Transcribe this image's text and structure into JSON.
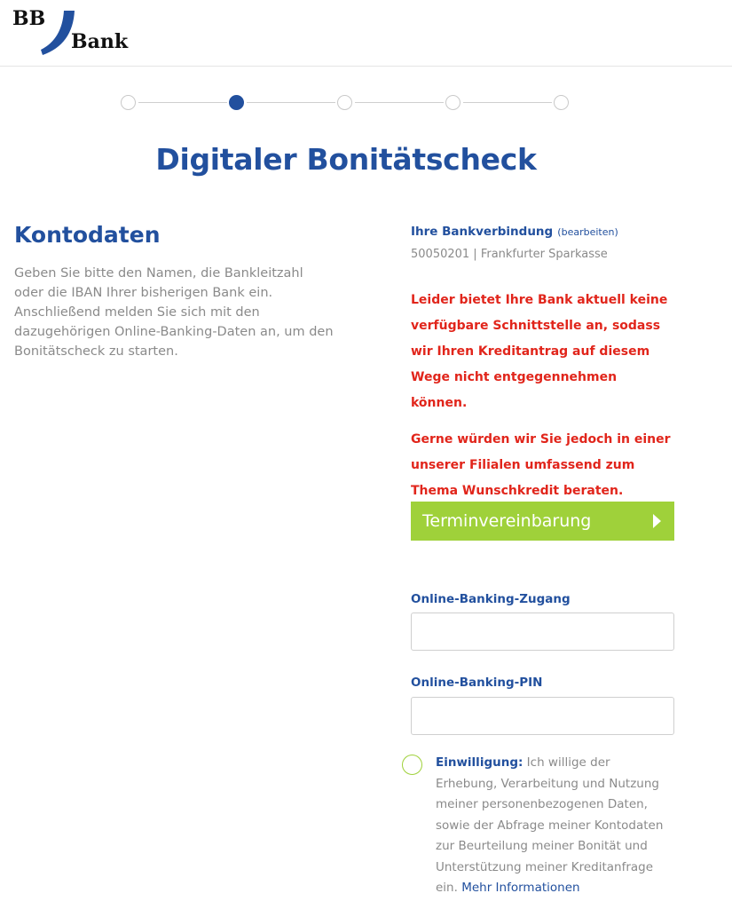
{
  "header": {
    "logo_bb": "BB",
    "logo_bank": "Bank",
    "brand_color": "#22509e"
  },
  "stepper": {
    "total": 5,
    "active_index": 1
  },
  "page": {
    "title": "Digitaler Bonitätscheck"
  },
  "left": {
    "heading": "Kontodaten",
    "description": "Geben Sie bitte den Namen, die Bankleitzahl oder die IBAN Ihrer bisherigen Bank ein. Anschließend melden Sie sich mit den dazugehörigen Online-Banking-Daten an, um den Bonitätscheck zu starten."
  },
  "bank": {
    "label": "Ihre Bankverbindung",
    "edit_link": "(bearbeiten)",
    "info": "50050201 | Frankfurter Sparkasse"
  },
  "errors": {
    "line1": "Leider bietet Ihre Bank aktuell keine verfügbare Schnittstelle an, sodass wir Ihren Kreditantrag auf diesem Wege nicht entgegennehmen können.",
    "line2": "Gerne würden wir Sie jedoch in einer unserer Filialen umfassend zum Thema Wunschkredit beraten.",
    "color": "#e1251b"
  },
  "cta": {
    "label": "Terminvereinbarung",
    "color": "#9fd13a"
  },
  "form": {
    "login_label": "Online-Banking-Zugang",
    "login_value": "",
    "pin_label": "Online-Banking-PIN",
    "pin_value": ""
  },
  "consent": {
    "title": "Einwilligung:",
    "text": " Ich willige der Erhebung, Verarbeitung und Nutzung meiner personenbezogenen Daten, sowie der Abfrage meiner Kontodaten zur Beurteilung meiner Bonität und Unterstützung meiner Kreditanfrage ein. ",
    "link": "Mehr Informationen"
  }
}
